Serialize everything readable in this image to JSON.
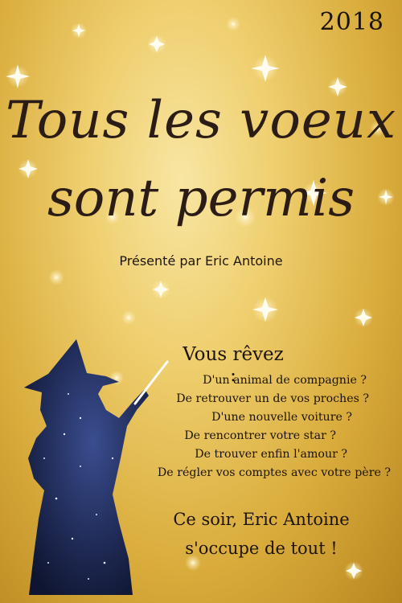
{
  "poster": {
    "year": "2018",
    "title_line1": "Tous les voeux",
    "title_line2": "sont permis",
    "presenter": "Présenté par Eric Antoine",
    "dream_heading": "Vous rêvez :",
    "dreams": [
      "D'un animal de compagnie ?",
      "De retrouver un de vos proches ?",
      "D'une nouvelle voiture ?",
      "De rencontrer votre star ?",
      "De trouver enfin l'amour ?",
      "De régler vos comptes avec votre père ?"
    ],
    "closing_line1": "Ce soir, Eric Antoine",
    "closing_line2": "s'occupe de tout !"
  },
  "colors": {
    "background_gold": "#e3bb53",
    "text_dark": "#1d140a",
    "wizard_night": "#1b2347"
  }
}
